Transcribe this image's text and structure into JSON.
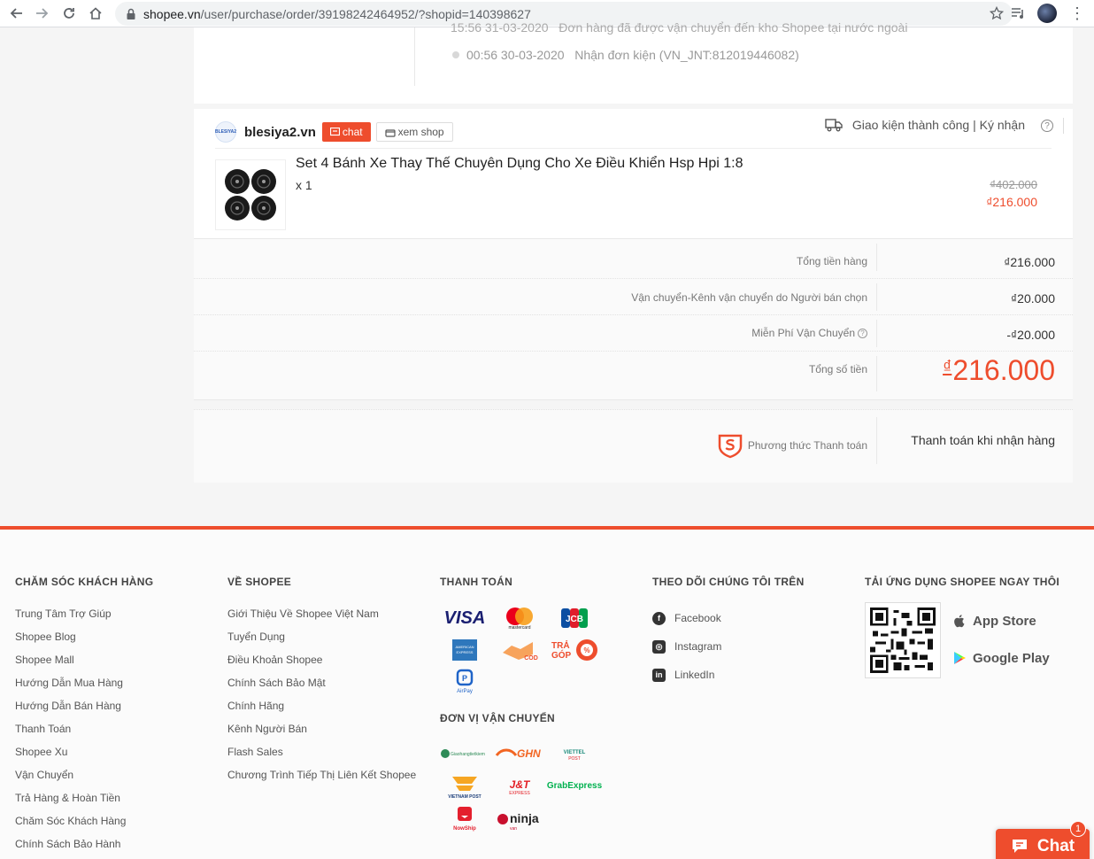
{
  "browser": {
    "url_host": "shopee.vn",
    "url_path": "/user/purchase/order/39198242464952/?shopid=140398627"
  },
  "tracking": {
    "prev_time": "15:56 31-03-2020",
    "prev_desc": "Đơn hàng đã được vận chuyển đến kho Shopee tại nước ngoài",
    "last_time": "00:56 30-03-2020",
    "last_desc": "Nhận đơn kiện (VN_JNT:812019446082)"
  },
  "shop": {
    "logo_text": "BLESIYA2",
    "name": "blesiya2.vn",
    "chat_label": "chat",
    "view_shop_label": "xem shop",
    "status": "Giao kiện thành công | Ký nhận",
    "help": "?"
  },
  "product": {
    "name": "Set 4 Bánh Xe Thay Thế Chuyên Dụng Cho Xe Điều Khiển Hsp Hpi 1:8",
    "qty": "x 1",
    "price_original": "₫402.000",
    "price_current": "₫216.000"
  },
  "summary": {
    "rows": [
      {
        "label": "Tổng tiền hàng",
        "value": "₫216.000"
      },
      {
        "label": "Vận chuyển-Kênh vận chuyển do Người bán chọn",
        "value": "₫20.000"
      },
      {
        "label": "Miễn Phí Vận Chuyển",
        "value": "-₫20.000"
      }
    ],
    "total_label": "Tổng số tiền",
    "total_currency": "₫",
    "total_value": "216.000"
  },
  "payment": {
    "label": "Phương thức Thanh toán",
    "value": "Thanh toán khi nhận hàng"
  },
  "footer": {
    "customer_care": {
      "heading": "CHĂM SÓC KHÁCH HÀNG",
      "links": [
        "Trung Tâm Trợ Giúp",
        "Shopee Blog",
        "Shopee Mall",
        "Hướng Dẫn Mua Hàng",
        "Hướng Dẫn Bán Hàng",
        "Thanh Toán",
        "Shopee Xu",
        "Vận Chuyển",
        "Trả Hàng & Hoàn Tiền",
        "Chăm Sóc Khách Hàng",
        "Chính Sách Bảo Hành"
      ]
    },
    "about": {
      "heading": "VỀ SHOPEE",
      "links": [
        "Giới Thiệu Về Shopee Việt Nam",
        "Tuyển Dụng",
        "Điều Khoản Shopee",
        "Chính Sách Bảo Mật",
        "Chính Hãng",
        "Kênh Người Bán",
        "Flash Sales",
        "Chương Trình Tiếp Thị Liên Kết Shopee"
      ]
    },
    "payment": {
      "heading": "THANH TOÁN",
      "logos": [
        "VISA",
        "mastercard",
        "JCB",
        "AMERICAN EXPRESS",
        "COD",
        "TRẢ GÓP",
        "AirPay"
      ]
    },
    "shipping": {
      "heading": "ĐƠN VỊ VẬN CHUYỂN",
      "logos": [
        "Giaohangtietkiem",
        "GHN",
        "VIETTEL POST",
        "VIETNAM POST",
        "J&T EXPRESS",
        "GrabExpress",
        "NowShip",
        "ninja van"
      ]
    },
    "follow": {
      "heading": "THEO DÕI CHÚNG TÔI TRÊN",
      "items": [
        {
          "label": "Facebook",
          "icon": "facebook-icon",
          "glyph": "f"
        },
        {
          "label": "Instagram",
          "icon": "instagram-icon",
          "glyph": "◎"
        },
        {
          "label": "LinkedIn",
          "icon": "linkedin-icon",
          "glyph": "in"
        }
      ]
    },
    "app": {
      "heading": "TẢI ỨNG DỤNG SHOPEE NGAY THÔI",
      "app_store": "App Store",
      "google_play": "Google Play"
    }
  },
  "chat_widget": {
    "label": "Chat",
    "badge": "1"
  },
  "colors": {
    "brand": "#ee4d2d",
    "text": "#333333",
    "muted": "#777777"
  }
}
